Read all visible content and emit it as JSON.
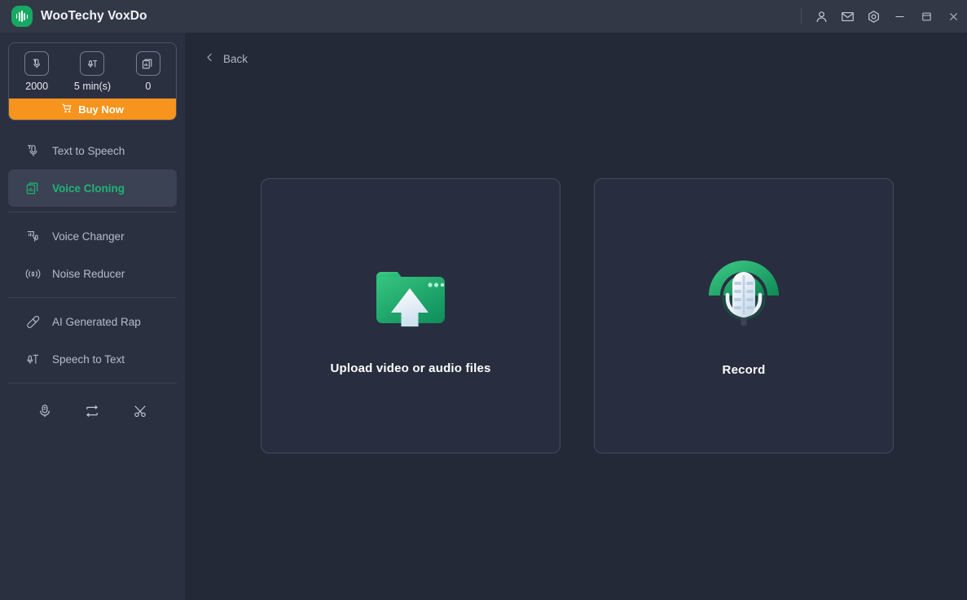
{
  "window": {
    "title": "WooTechy VoxDo",
    "logo_icon": "voxdo-logo-icon",
    "controls": [
      {
        "name": "account-icon",
        "label": "Account"
      },
      {
        "name": "mail-icon",
        "label": "Mail"
      },
      {
        "name": "settings-icon",
        "label": "Settings"
      },
      {
        "name": "minimize-icon",
        "label": "Minimize"
      },
      {
        "name": "maximize-icon",
        "label": "Maximize"
      },
      {
        "name": "close-icon",
        "label": "Close"
      }
    ]
  },
  "sidebar": {
    "credits": {
      "items": [
        {
          "icon": "text-to-speech-icon",
          "value": "2000"
        },
        {
          "icon": "speech-to-text-icon",
          "value": "5 min(s)"
        },
        {
          "icon": "voice-cloning-icon",
          "value": "0"
        }
      ],
      "buy_label": "Buy Now",
      "buy_icon": "cart-icon"
    },
    "items": [
      {
        "label": "Text to Speech",
        "icon": "text-to-speech-icon",
        "active": false
      },
      {
        "label": "Voice Cloning",
        "icon": "voice-cloning-icon",
        "active": true
      },
      {
        "label": "Voice Changer",
        "icon": "voice-changer-icon",
        "active": false
      },
      {
        "label": "Noise Reducer",
        "icon": "noise-reducer-icon",
        "active": false
      },
      {
        "label": "AI Generated Rap",
        "icon": "ai-generated-rap-icon",
        "active": false
      },
      {
        "label": "Speech to Text",
        "icon": "speech-to-text-icon",
        "active": false
      }
    ],
    "tools": [
      {
        "icon": "microphone-icon"
      },
      {
        "icon": "convert-icon"
      },
      {
        "icon": "scissors-icon"
      }
    ]
  },
  "main": {
    "back_label": "Back",
    "back_icon": "chevron-left-icon",
    "cards": [
      {
        "label": "Upload video or audio files",
        "icon": "upload-folder-icon"
      },
      {
        "label": "Record",
        "icon": "record-microphone-icon"
      }
    ]
  },
  "colors": {
    "accent_green": "#1fb474",
    "buy_orange": "#f7941d",
    "titlebar": "#323846",
    "sidebar": "#2a3040",
    "main_bg": "#242938",
    "card_bg": "#282e3f",
    "card_border": "#434a5c"
  }
}
